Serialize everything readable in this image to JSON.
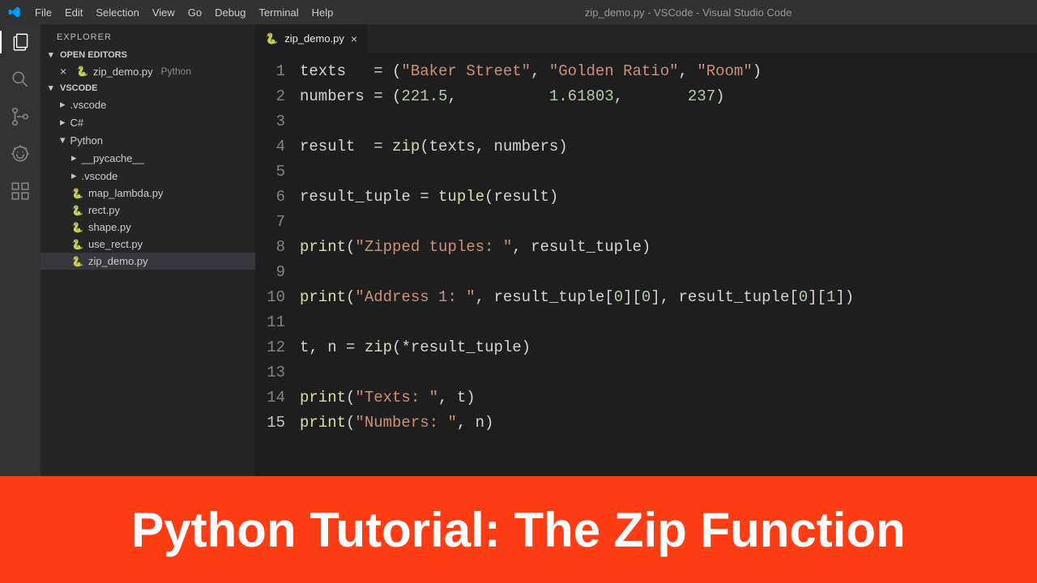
{
  "titlebar": {
    "menu": [
      "File",
      "Edit",
      "Selection",
      "View",
      "Go",
      "Debug",
      "Terminal",
      "Help"
    ],
    "title": "zip_demo.py - VSCode - Visual Studio Code"
  },
  "sidebar": {
    "header": "EXPLORER",
    "openEditors": "OPEN EDITORS",
    "openFile": "zip_demo.py",
    "openFileLang": "Python",
    "workspace": "VSCODE",
    "tree": {
      "vscode_folder": ".vscode",
      "csharp": "C#",
      "python": "Python",
      "pycache": "__pycache__",
      "vscode_sub": ".vscode",
      "f1": "map_lambda.py",
      "f2": "rect.py",
      "f3": "shape.py",
      "f4": "use_rect.py",
      "f5": "zip_demo.py"
    }
  },
  "tab": {
    "name": "zip_demo.py"
  },
  "code": {
    "lines": [
      "1",
      "2",
      "3",
      "4",
      "5",
      "6",
      "7",
      "8",
      "9",
      "10",
      "11",
      "12",
      "13",
      "14",
      "15"
    ],
    "l1_a": "texts   = (",
    "l1_s1": "\"Baker Street\"",
    "l1_b": ", ",
    "l1_s2": "\"Golden Ratio\"",
    "l1_c": ", ",
    "l1_s3": "\"Room\"",
    "l1_d": ")",
    "l2_a": "numbers = (",
    "l2_n1": "221.5",
    "l2_b": ",          ",
    "l2_n2": "1.61803",
    "l2_c": ",       ",
    "l2_n3": "237",
    "l2_d": ")",
    "l4_a": "result  = ",
    "l4_f": "zip",
    "l4_b": "(texts, numbers)",
    "l6_a": "result_tuple = ",
    "l6_f": "tuple",
    "l6_b": "(result)",
    "l8_f": "print",
    "l8_a": "(",
    "l8_s": "\"Zipped tuples: \"",
    "l8_b": ", result_tuple)",
    "l10_f": "print",
    "l10_a": "(",
    "l10_s": "\"Address 1: \"",
    "l10_b": ", result_tuple[",
    "l10_n1": "0",
    "l10_c": "][",
    "l10_n2": "0",
    "l10_d": "], result_tuple[",
    "l10_n3": "0",
    "l10_e": "][",
    "l10_n4": "1",
    "l10_g": "])",
    "l12_a": "t, n = ",
    "l12_f": "zip",
    "l12_b": "(*result_tuple)",
    "l14_f": "print",
    "l14_a": "(",
    "l14_s": "\"Texts: \"",
    "l14_b": ", t)",
    "l15_f": "print",
    "l15_a": "(",
    "l15_s": "\"Numbers: \"",
    "l15_b": ", n)"
  },
  "banner": "Python Tutorial: The Zip Function"
}
